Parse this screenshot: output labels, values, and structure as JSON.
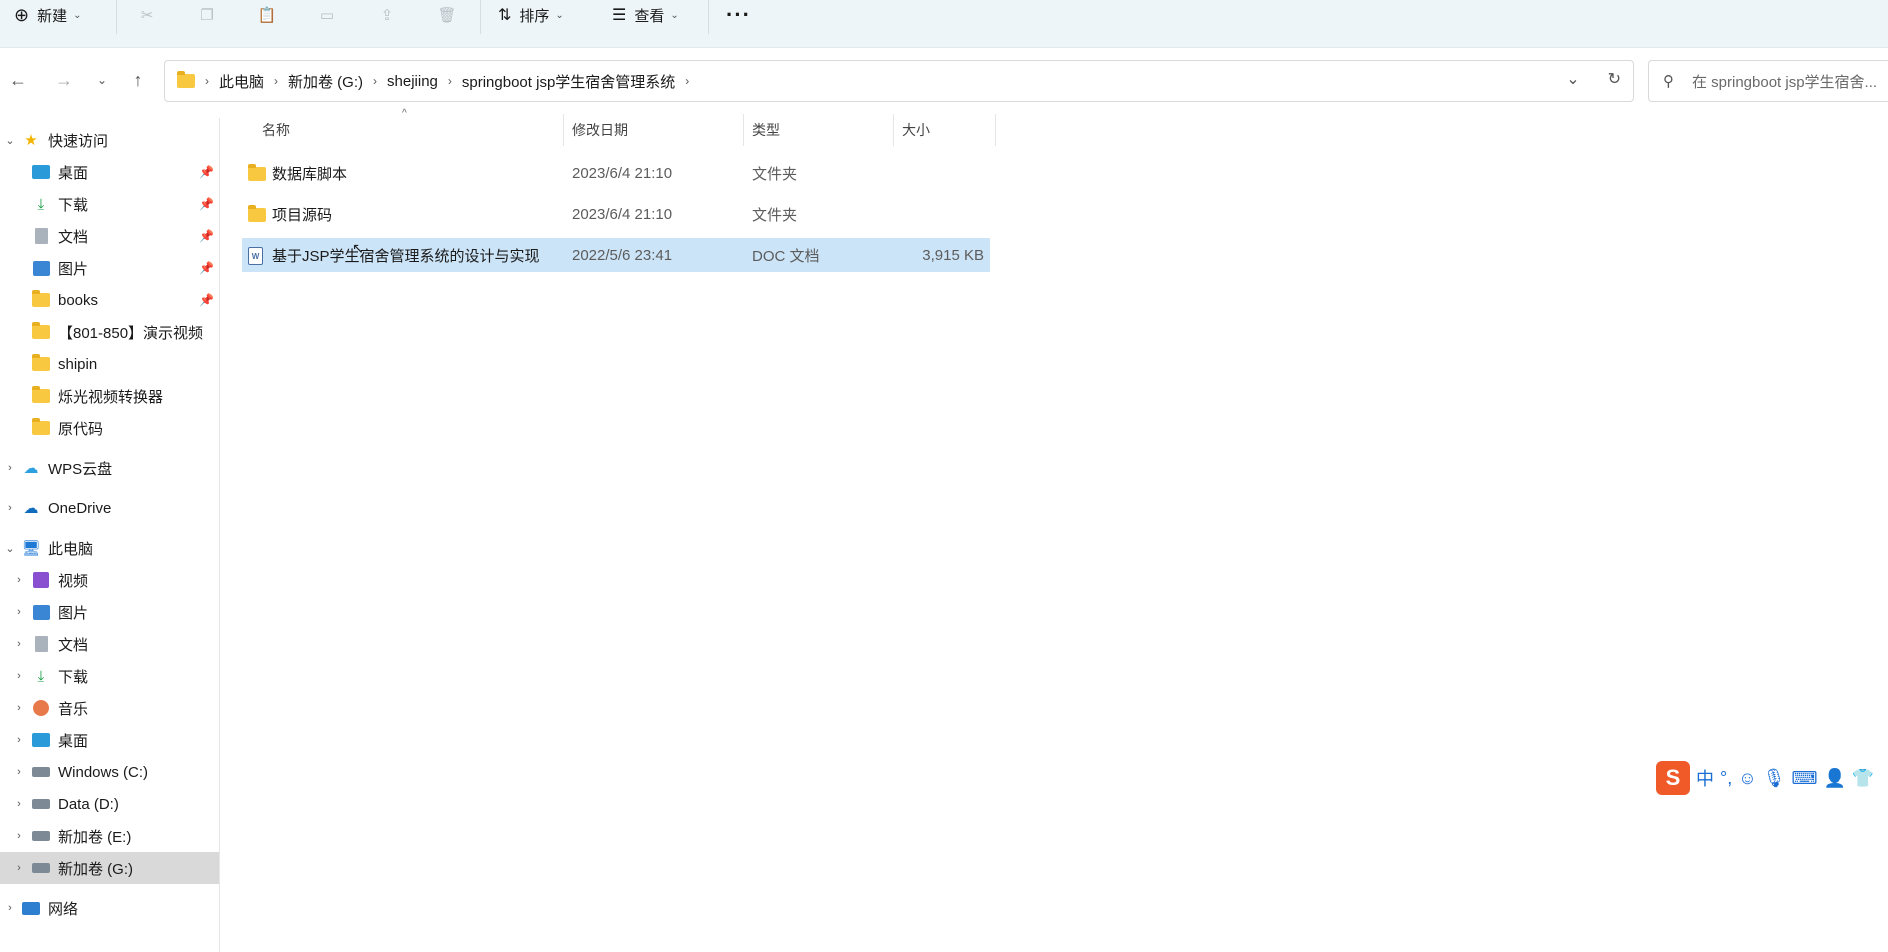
{
  "toolbar": {
    "new_label": "新建",
    "sort_label": "排序",
    "view_label": "查看",
    "more_label": "···"
  },
  "address": {
    "crumbs": [
      "此电脑",
      "新加卷 (G:)",
      "shejiing",
      "springboot jsp学生宿舍管理系统"
    ]
  },
  "search": {
    "placeholder": "在 springboot jsp学生宿舍..."
  },
  "sidebar": {
    "quick_access": "快速访问",
    "quick_items": [
      {
        "label": "桌面",
        "pinned": true
      },
      {
        "label": "下载",
        "pinned": true
      },
      {
        "label": "文档",
        "pinned": true
      },
      {
        "label": "图片",
        "pinned": true
      },
      {
        "label": "books",
        "pinned": true
      },
      {
        "label": "【801-850】演示视频",
        "pinned": false
      },
      {
        "label": "shipin",
        "pinned": false
      },
      {
        "label": "烁光视频转换器",
        "pinned": false
      },
      {
        "label": "原代码",
        "pinned": false
      }
    ],
    "wps": "WPS云盘",
    "onedrive": "OneDrive",
    "this_pc": "此电脑",
    "pc_items": [
      {
        "label": "视频"
      },
      {
        "label": "图片"
      },
      {
        "label": "文档"
      },
      {
        "label": "下载"
      },
      {
        "label": "音乐"
      },
      {
        "label": "桌面"
      },
      {
        "label": "Windows (C:)"
      },
      {
        "label": "Data (D:)"
      },
      {
        "label": "新加卷 (E:)"
      },
      {
        "label": "新加卷 (G:)"
      }
    ],
    "network": "网络"
  },
  "columns": {
    "name": "名称",
    "date": "修改日期",
    "type": "类型",
    "size": "大小"
  },
  "files": [
    {
      "name": "数据库脚本",
      "date": "2023/6/4 21:10",
      "type": "文件夹",
      "size": "",
      "kind": "folder"
    },
    {
      "name": "项目源码",
      "date": "2023/6/4 21:10",
      "type": "文件夹",
      "size": "",
      "kind": "folder"
    },
    {
      "name": "基于JSP学生宿舍管理系统的设计与实现",
      "date": "2022/5/6 23:41",
      "type": "DOC 文档",
      "size": "3,915 KB",
      "kind": "doc",
      "selected": true
    }
  ],
  "ime": {
    "logo": "S",
    "mode": "中"
  }
}
